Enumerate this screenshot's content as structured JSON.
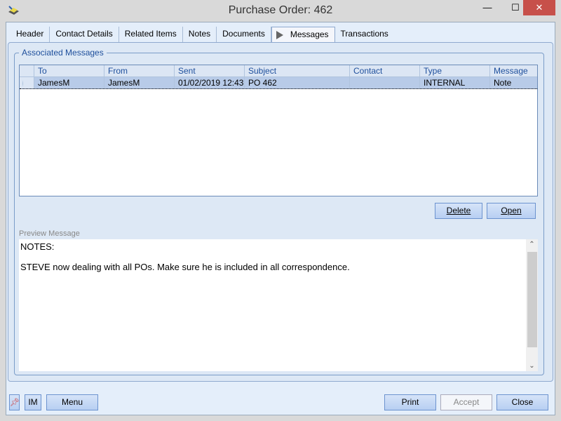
{
  "window": {
    "title": "Purchase Order: 462",
    "minimize": "—",
    "maximize": "☐",
    "close": "✕"
  },
  "tabs": [
    "Header",
    "Contact Details",
    "Related Items",
    "Notes",
    "Documents",
    "Messages",
    "Transactions"
  ],
  "active_tab": "Messages",
  "group": {
    "label": "Associated Messages"
  },
  "grid": {
    "columns": [
      "To",
      "From",
      "Sent",
      "Subject",
      "Contact",
      "Type",
      "Message"
    ],
    "rows": [
      [
        "JamesM",
        "JamesM",
        "01/02/2019 12:43",
        "PO 462",
        "",
        "INTERNAL",
        "Note"
      ]
    ]
  },
  "buttons": {
    "delete": "Delete",
    "open": "Open",
    "im": "IM",
    "menu": "Menu",
    "print": "Print",
    "accept": "Accept",
    "close": "Close"
  },
  "preview": {
    "label": "Preview Message",
    "lines": [
      "NOTES:",
      "STEVE now dealing with all POs. Make sure he is included in all correspondence."
    ]
  }
}
